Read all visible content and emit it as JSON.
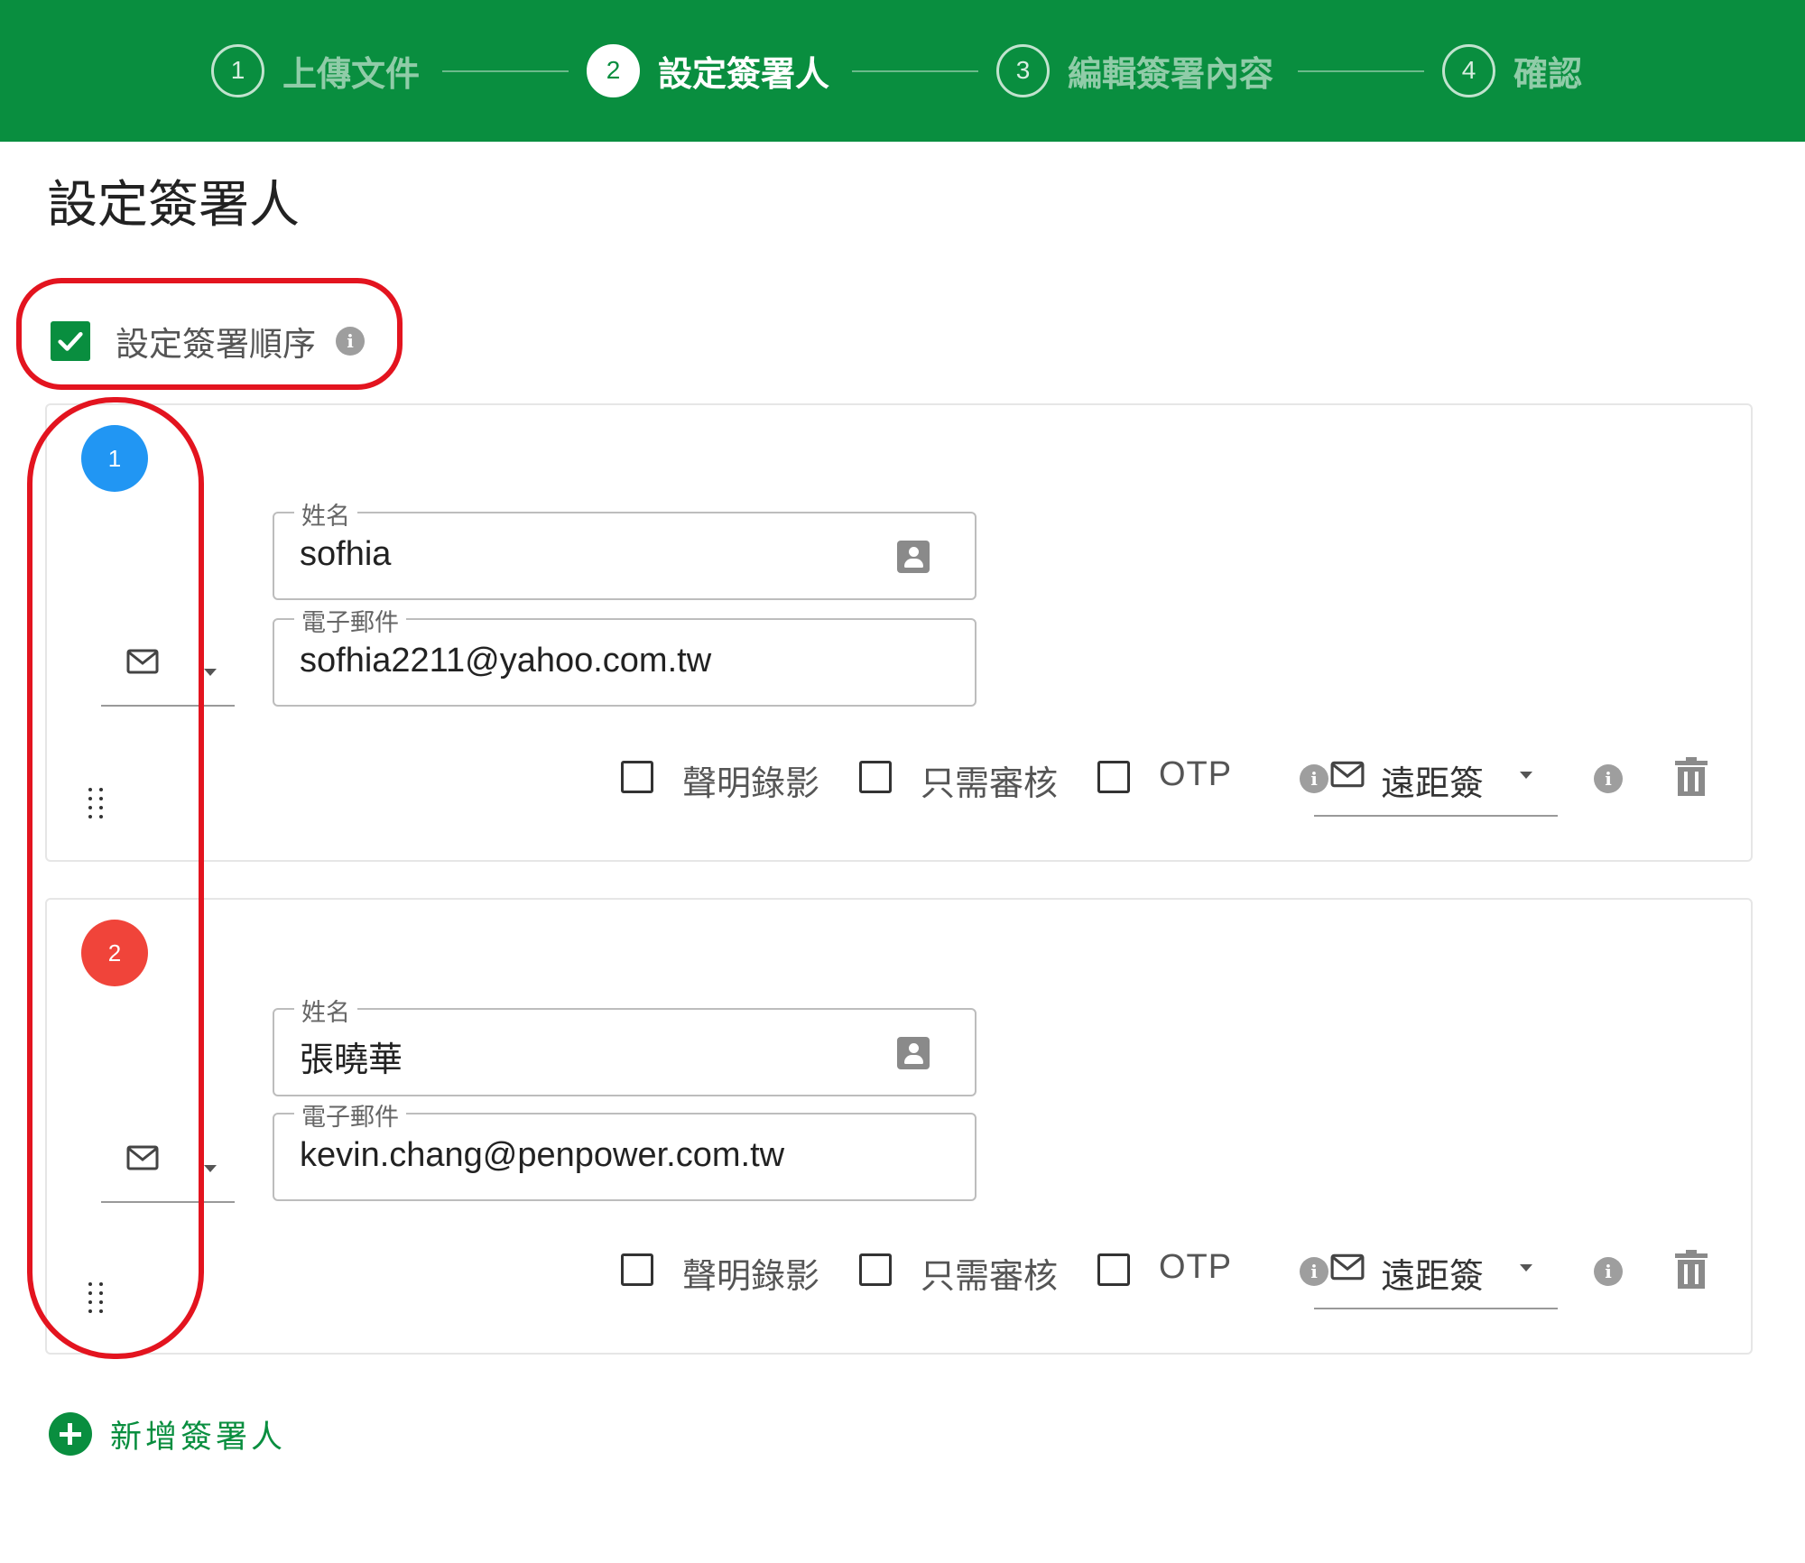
{
  "colors": {
    "brand_green": "#098e3f",
    "badge_blue": "#2196f3",
    "badge_red": "#f0443a",
    "annotation_red": "#e3141f"
  },
  "stepper": {
    "steps": [
      {
        "number": "1",
        "label": "上傳文件",
        "state": "inactive"
      },
      {
        "number": "2",
        "label": "設定簽署人",
        "state": "active"
      },
      {
        "number": "3",
        "label": "編輯簽署內容",
        "state": "inactive"
      },
      {
        "number": "4",
        "label": "確認",
        "state": "inactive"
      }
    ]
  },
  "page": {
    "title": "設定簽署人"
  },
  "order": {
    "label": "設定簽署順序",
    "checked": true,
    "info_icon": "info-icon"
  },
  "signers": [
    {
      "order": "1",
      "badge_color": "#2196f3",
      "method_icon": "mail-icon",
      "name_label": "姓名",
      "name_value": "sofhia",
      "email_label": "電子郵件",
      "email_value": "sofhia2211@yahoo.com.tw",
      "options": [
        "聲明錄影",
        "只需審核",
        "OTP"
      ],
      "sign_mode": "遠距簽"
    },
    {
      "order": "2",
      "badge_color": "#f0443a",
      "method_icon": "mail-icon",
      "name_label": "姓名",
      "name_value": "張曉華",
      "email_label": "電子郵件",
      "email_value": "kevin.chang@penpower.com.tw",
      "options": [
        "聲明錄影",
        "只需審核",
        "OTP"
      ],
      "sign_mode": "遠距簽"
    }
  ],
  "add_signer": {
    "label": "新增簽署人"
  }
}
